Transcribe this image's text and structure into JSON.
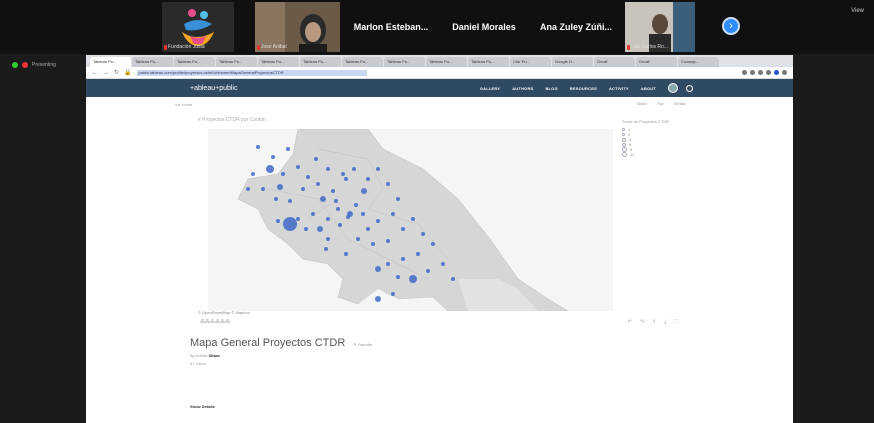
{
  "zoom": {
    "participants": [
      {
        "kind": "logo",
        "caption": "Fundación Justa"
      },
      {
        "kind": "video",
        "caption": "Jose Anibal"
      },
      {
        "kind": "name",
        "name": "Marlon  Esteban..."
      },
      {
        "kind": "name",
        "name": "Daniel Morales"
      },
      {
        "kind": "name",
        "name": "Ana Zuley Zúñi..."
      },
      {
        "kind": "video",
        "caption": "Luis Carlos Ro..."
      }
    ],
    "next_icon": "chevron-right-icon",
    "view_label": "View",
    "share_label": "Presenting"
  },
  "browser": {
    "tabs": [
      "Tableau Pu...",
      "Tableau Pu...",
      "Tableau Pu...",
      "Tableau Pu...",
      "Tableau Pu...",
      "Tableau Pu...",
      "Tableau Pu...",
      "Tableau Pu...",
      "Tableau Pu...",
      "Tableau Pu...",
      "Ctdr Pu...",
      "Google D...",
      "Gmail",
      "Gmail",
      "Consejo..."
    ],
    "url": "public.tableau.com/profile/proyectos.ctdr#!/vizhome/MapaGeneralProyectosCTDR"
  },
  "tableau": {
    "brand": "+ableau+public",
    "nav": [
      "GALLERY",
      "AUTHORS",
      "BLOG",
      "RESOURCES",
      "ACTIVITY",
      "ABOUT"
    ],
    "breadcrumb": "Viz Home",
    "actions": [
      "Share",
      "Fav",
      "Similar"
    ],
    "viz_title": "# Proyectos CTDR por Cantón",
    "legend_title": "Suma de Proyectos CTDR",
    "legend_items": [
      "1",
      "2",
      "4",
      "6",
      "8",
      "10"
    ],
    "source": "© OpenStreetMap © Mapbox",
    "page_title": "Mapa General Proyectos CTDR",
    "favorite_label": "Favorite",
    "author_prefix": "By Author",
    "author_name": "Sitara",
    "views": "87 Views",
    "more_label": "Show Details"
  }
}
